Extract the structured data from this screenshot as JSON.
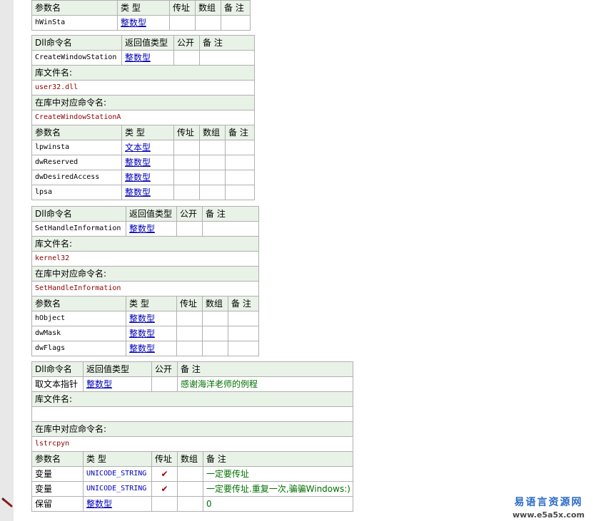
{
  "labels": {
    "param_name": "参数名",
    "type": "类 型",
    "by_ref": "传址",
    "array": "数组",
    "remark": "备 注",
    "dll_cmd_name": "Dll命令名",
    "return_type": "返回值类型",
    "public": "公开",
    "lib_file": "库文件名:",
    "lib_cmd_name": "在库中对应命令名:"
  },
  "top_table": {
    "params": [
      {
        "name": "hWinSta",
        "type": "整数型"
      }
    ]
  },
  "commands": [
    {
      "name": "CreateWindowStation",
      "return_type": "整数型",
      "remark": "",
      "lib_file": "user32.dll",
      "lib_cmd": "CreateWindowStationA",
      "params": [
        {
          "name": "lpwinsta",
          "type": "文本型"
        },
        {
          "name": "dwReserved",
          "type": "整数型"
        },
        {
          "name": "dwDesiredAccess",
          "type": "整数型"
        },
        {
          "name": "lpsa",
          "type": "整数型"
        }
      ]
    },
    {
      "name": "SetHandleInformation",
      "return_type": "整数型",
      "remark": "",
      "lib_file": "kernel32",
      "lib_cmd": "SetHandleInformation",
      "params": [
        {
          "name": "hObject",
          "type": "整数型"
        },
        {
          "name": "dwMask",
          "type": "整数型"
        },
        {
          "name": "dwFlags",
          "type": "整数型"
        }
      ]
    },
    {
      "name": "取文本指针",
      "return_type": "整数型",
      "remark": "感谢海洋老师的例程",
      "lib_file": "",
      "lib_cmd": "lstrcpyn",
      "params": [
        {
          "name": "变量",
          "type": "UNICODE_STRING",
          "by_ref": "✔",
          "remark": "一定要传址"
        },
        {
          "name": "变量",
          "type": "UNICODE_STRING",
          "by_ref": "✔",
          "remark": "一定要传址.重复一次,骗骗Windows:)"
        },
        {
          "name": "保留",
          "type": "整数型",
          "by_ref": "",
          "remark": "0"
        }
      ]
    }
  ],
  "watermark": {
    "title": "易语言资源网",
    "url": "www.e5a5x.com"
  }
}
